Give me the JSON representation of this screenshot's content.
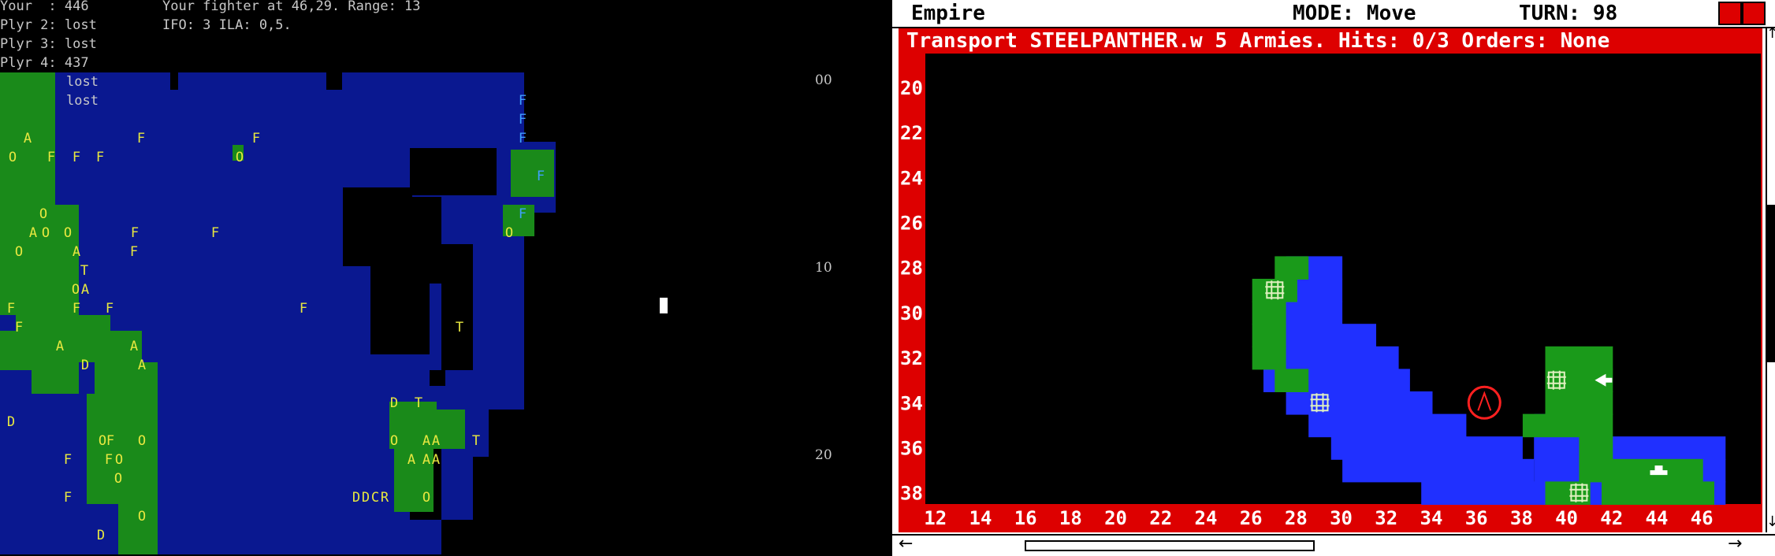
{
  "console": {
    "lines": [
      "Your  : 446",
      "Plyr 2: lost",
      "Plyr 3: lost",
      "Plyr 4: 437"
    ],
    "extra_lines": [
      "lost",
      "lost"
    ],
    "message1": "Your fighter at 46,29. Range: 13",
    "message2": "IFO: 3 ILA: 0,5.",
    "row_labels": [
      "00",
      "10",
      "20"
    ]
  },
  "left_units": [
    {
      "t": "F",
      "c": 663,
      "r": 5,
      "color": "#40a0ff"
    },
    {
      "t": "F",
      "c": 663,
      "r": 6,
      "color": "#40a0ff"
    },
    {
      "t": "F",
      "c": 663,
      "r": 7,
      "color": "#40a0ff"
    },
    {
      "t": "A",
      "c": 35,
      "r": 7
    },
    {
      "t": "F",
      "c": 179,
      "r": 7
    },
    {
      "t": "F",
      "c": 325,
      "r": 7
    },
    {
      "t": "O",
      "c": 16,
      "r": 8
    },
    {
      "t": "F",
      "c": 65,
      "r": 8
    },
    {
      "t": "F",
      "c": 97,
      "r": 8
    },
    {
      "t": "F",
      "c": 127,
      "r": 8
    },
    {
      "t": "O",
      "c": 304,
      "r": 8
    },
    {
      "t": "F",
      "c": 686,
      "r": 9,
      "color": "#40a0ff"
    },
    {
      "t": "O",
      "c": 55,
      "r": 11
    },
    {
      "t": "F",
      "c": 663,
      "r": 11,
      "color": "#40a0ff"
    },
    {
      "t": "A",
      "c": 42,
      "r": 12
    },
    {
      "t": "O",
      "c": 58,
      "r": 12
    },
    {
      "t": "O",
      "c": 86,
      "r": 12
    },
    {
      "t": "F",
      "c": 171,
      "r": 12
    },
    {
      "t": "F",
      "c": 273,
      "r": 12
    },
    {
      "t": "O",
      "c": 646,
      "r": 12
    },
    {
      "t": "O",
      "c": 24,
      "r": 13
    },
    {
      "t": "A",
      "c": 97,
      "r": 13
    },
    {
      "t": "F",
      "c": 170,
      "r": 13
    },
    {
      "t": "T",
      "c": 107,
      "r": 14
    },
    {
      "t": "O",
      "c": 96,
      "r": 15
    },
    {
      "t": "A",
      "c": 108,
      "r": 15
    },
    {
      "t": "F",
      "c": 14,
      "r": 16
    },
    {
      "t": "F",
      "c": 97,
      "r": 16
    },
    {
      "t": "F",
      "c": 139,
      "r": 16
    },
    {
      "t": "F",
      "c": 385,
      "r": 16
    },
    {
      "t": "F",
      "c": 24,
      "r": 17
    },
    {
      "t": "T",
      "c": 583,
      "r": 17
    },
    {
      "t": "A",
      "c": 76,
      "r": 18
    },
    {
      "t": "A",
      "c": 170,
      "r": 18
    },
    {
      "t": "D",
      "c": 108,
      "r": 19
    },
    {
      "t": "A",
      "c": 180,
      "r": 19
    },
    {
      "t": "D",
      "c": 500,
      "r": 21
    },
    {
      "t": "T",
      "c": 531,
      "r": 21
    },
    {
      "t": "D",
      "c": 14,
      "r": 22
    },
    {
      "t": "O",
      "c": 130,
      "r": 23
    },
    {
      "t": "F",
      "c": 140,
      "r": 23
    },
    {
      "t": "O",
      "c": 180,
      "r": 23
    },
    {
      "t": "O",
      "c": 500,
      "r": 23
    },
    {
      "t": "A",
      "c": 541,
      "r": 23
    },
    {
      "t": "A",
      "c": 553,
      "r": 23
    },
    {
      "t": "T",
      "c": 604,
      "r": 23
    },
    {
      "t": "F",
      "c": 86,
      "r": 24
    },
    {
      "t": "F",
      "c": 138,
      "r": 24
    },
    {
      "t": "O",
      "c": 151,
      "r": 24
    },
    {
      "t": "A",
      "c": 522,
      "r": 24
    },
    {
      "t": "A",
      "c": 541,
      "r": 24
    },
    {
      "t": "A",
      "c": 553,
      "r": 24
    },
    {
      "t": "O",
      "c": 150,
      "r": 25
    },
    {
      "t": "F",
      "c": 86,
      "r": 26
    },
    {
      "t": "D",
      "c": 452,
      "r": 26
    },
    {
      "t": "D",
      "c": 464,
      "r": 26
    },
    {
      "t": "C",
      "c": 476,
      "r": 26
    },
    {
      "t": "R",
      "c": 488,
      "r": 26
    },
    {
      "t": "O",
      "c": 541,
      "r": 26
    },
    {
      "t": "O",
      "c": 180,
      "r": 27
    },
    {
      "t": "D",
      "c": 128,
      "r": 28
    }
  ],
  "window": {
    "title": "Empire",
    "mode": "MODE: Move",
    "turn": "TURN: 98",
    "info": "Transport STEELPANTHER.w 5 Armies. Hits: 0/3 Orders: None"
  },
  "map": {
    "row_labels": [
      "20",
      "22",
      "24",
      "26",
      "28",
      "30",
      "32",
      "34",
      "36",
      "38"
    ],
    "col_labels": [
      "12",
      "14",
      "16",
      "18",
      "20",
      "22",
      "24",
      "26",
      "28",
      "30",
      "32",
      "34",
      "36",
      "38",
      "40",
      "42",
      "44",
      "46"
    ],
    "first_row": 19,
    "first_col": 12,
    "colors": {
      "sea": "#2030ff",
      "land": "#1a9a1a",
      "frame": "#d00000",
      "unknown": "#000000"
    }
  }
}
